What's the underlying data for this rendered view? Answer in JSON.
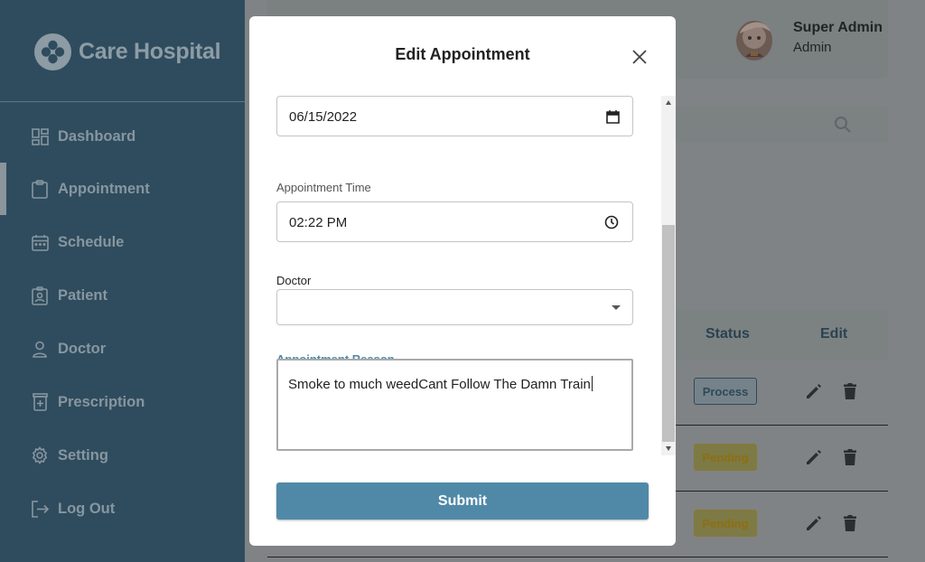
{
  "app": {
    "brand_name": "Care Hospital"
  },
  "sidebar": {
    "items": [
      {
        "label": "Dashboard",
        "icon": "dashboard-icon"
      },
      {
        "label": "Appointment",
        "icon": "clipboard-icon",
        "active": true
      },
      {
        "label": "Schedule",
        "icon": "calendar-icon"
      },
      {
        "label": "Patient",
        "icon": "patient-badge-icon"
      },
      {
        "label": "Doctor",
        "icon": "person-icon"
      },
      {
        "label": "Prescription",
        "icon": "prescription-icon"
      },
      {
        "label": "Setting",
        "icon": "gear-icon"
      },
      {
        "label": "Log Out",
        "icon": "logout-icon"
      }
    ]
  },
  "header": {
    "user_name": "Super Admin",
    "user_role": "Admin"
  },
  "table": {
    "columns": {
      "status": "Status",
      "edit": "Edit"
    },
    "rows": [
      {
        "status": "Process"
      },
      {
        "status": "Pending"
      },
      {
        "status": "Pending"
      }
    ]
  },
  "modal": {
    "title": "Edit Appointment",
    "date_value": "06/15/2022",
    "time_label": "Appointment Time",
    "time_value": "02:22 PM",
    "doctor_label": "Doctor",
    "doctor_value": "",
    "reason_label": "Appointment Reason",
    "reason_value": "Smoke to much weedCant Follow The Damn Train",
    "submit_label": "Submit"
  },
  "colors": {
    "sidebar_bg": "#2f4c5e",
    "accent": "#5089a8",
    "process_badge": "#2d4a5a",
    "pending_badge": "#c9a227"
  }
}
